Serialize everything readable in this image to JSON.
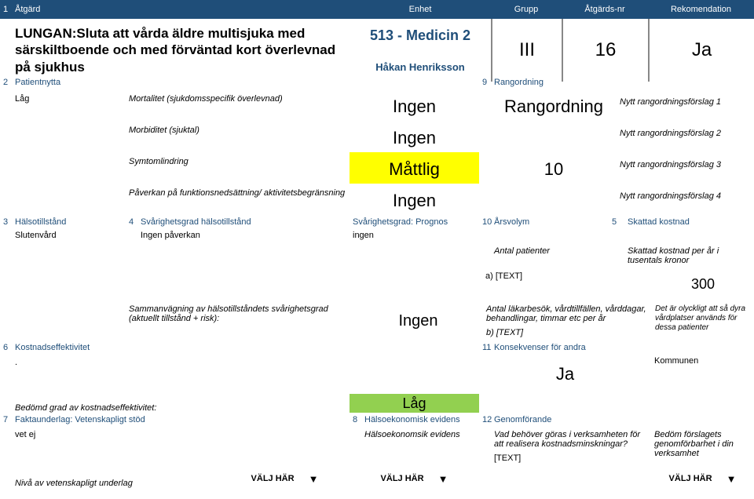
{
  "header": {
    "num": "1",
    "atgard": "Åtgärd",
    "enhet": "Enhet",
    "grupp": "Grupp",
    "nr": "Åtgärds-nr",
    "rek": "Rekomendation"
  },
  "title": {
    "atgard": "LUNGAN:Sluta att vårda äldre multisjuka med särskiltboende och med förväntad kort överlevnad på sjukhus",
    "enhet_main": "513 - Medicin 2",
    "enhet_sub": "Håkan Henriksson",
    "grupp": "III",
    "nr": "16",
    "rek": "Ja"
  },
  "sec2": {
    "num": "2",
    "label": "Patientnytta",
    "value": "Låg",
    "rows": [
      {
        "label": "Mortalitet (sjukdomsspecifik överlevnad)",
        "value": "Ingen"
      },
      {
        "label": "Morbiditet (sjuktal)",
        "value": "Ingen"
      },
      {
        "label": "Symtomlindring",
        "value": "Måttlig"
      },
      {
        "label": "Påverkan på funktionsnedsättning/ aktivitetsbegränsning",
        "value": "Ingen"
      }
    ]
  },
  "sec9": {
    "num": "9",
    "label": "Rangordning",
    "ordning_label": "Rangordning",
    "num_value": "10",
    "forslag": [
      "Nytt rangordningsförslag 1",
      "Nytt rangordningsförslag 2",
      "Nytt rangordningsförslag 3",
      "Nytt rangordningsförslag 4"
    ]
  },
  "sec3": {
    "num": "3",
    "label": "Hälsotillstånd",
    "value": "Slutenvård"
  },
  "sec4": {
    "num": "4",
    "label": "Svårighetsgrad hälsotillstånd",
    "value": "Ingen påverkan",
    "summ_label": "Sammanvägning av hälsotillståndets svårighetsgrad (aktuellt tillstånd + risk):",
    "summ_value": "Ingen"
  },
  "prognos": {
    "label": "Svårighetsgrad: Prognos",
    "value": "ingen"
  },
  "sec10": {
    "num": "10",
    "label": "Årsvolym",
    "patients_label": "Antal patienter",
    "a_label": "a) [TEXT]",
    "visits_label": "Antal läkarbesök, vårdtillfällen, vårddagar, behandlingar, timmar etc per år",
    "b_label": "b) [TEXT]"
  },
  "sec5": {
    "num": "5",
    "label": "Skattad kostnad",
    "sub_label": "Skattad kostnad per år i tusentals kronor",
    "value": "300",
    "comment": "Det är olyckligt att så dyra vårdplatser används för dessa patienter"
  },
  "sec6": {
    "num": "6",
    "label": "Kostnadseffektivitet",
    "value": ".",
    "bedomd_label": "Bedömd grad av kostnadseffektivitet:",
    "bedomd_value": "Låg"
  },
  "sec11": {
    "num": "11",
    "label": "Konsekvenser för andra",
    "value": "Ja",
    "kommunen": "Kommunen"
  },
  "sec7": {
    "num": "7",
    "label": "Faktaunderlag: Vetenskapligt stöd",
    "value": "vet ej",
    "niva_label": "Nivå av vetenskapligt underlag"
  },
  "sec8": {
    "num": "8",
    "label": "Hälsoekonomisk evidens",
    "sub_label": "Hälsoekonomsik evidens"
  },
  "sec12": {
    "num": "12",
    "label": "Genomförande",
    "q_label": "Vad behöver göras i verksamheten för att realisera kostnadsminskningar?",
    "text": "[TEXT]",
    "bedom_label": "Bedöm förslagets genomförbarhet i din verksamhet"
  },
  "valj": "VÄLJ HÄR",
  "tri": "▼"
}
